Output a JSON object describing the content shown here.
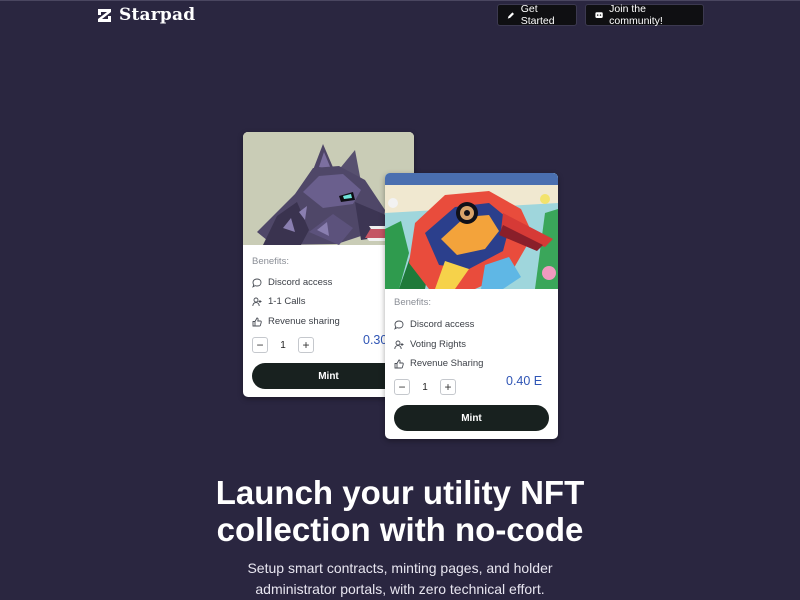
{
  "brand": {
    "name": "Starpad"
  },
  "nav": {
    "get_started": "Get Started",
    "community": "Join the community!"
  },
  "cards": [
    {
      "image": "wolf-pixel-art",
      "benefits_title": "Benefits:",
      "benefits": [
        {
          "icon": "chat-bubble-icon",
          "label": "Discord access"
        },
        {
          "icon": "user-plus-icon",
          "label": "1-1 Calls"
        },
        {
          "icon": "thumbs-up-icon",
          "label": "Revenue sharing"
        }
      ],
      "quantity": "1",
      "price": "0.30",
      "mint_label": "Mint"
    },
    {
      "image": "colorful-bird-art",
      "benefits_title": "Benefits:",
      "benefits": [
        {
          "icon": "chat-bubble-icon",
          "label": "Discord access"
        },
        {
          "icon": "user-plus-icon",
          "label": "Voting Rights"
        },
        {
          "icon": "thumbs-up-icon",
          "label": "Revenue Sharing"
        }
      ],
      "quantity": "1",
      "price": "0.40 E",
      "mint_label": "Mint"
    }
  ],
  "hero": {
    "title_line1": "Launch your utility NFT",
    "title_line2": "collection with no-code",
    "subtitle_line1": "Setup smart contracts, minting pages, and holder",
    "subtitle_line2": "administrator portals, with zero technical effort."
  },
  "colors": {
    "background": "#2a2640",
    "button_dark": "#0f0f12",
    "mint_button": "#18211f",
    "price": "#2f55b5"
  }
}
